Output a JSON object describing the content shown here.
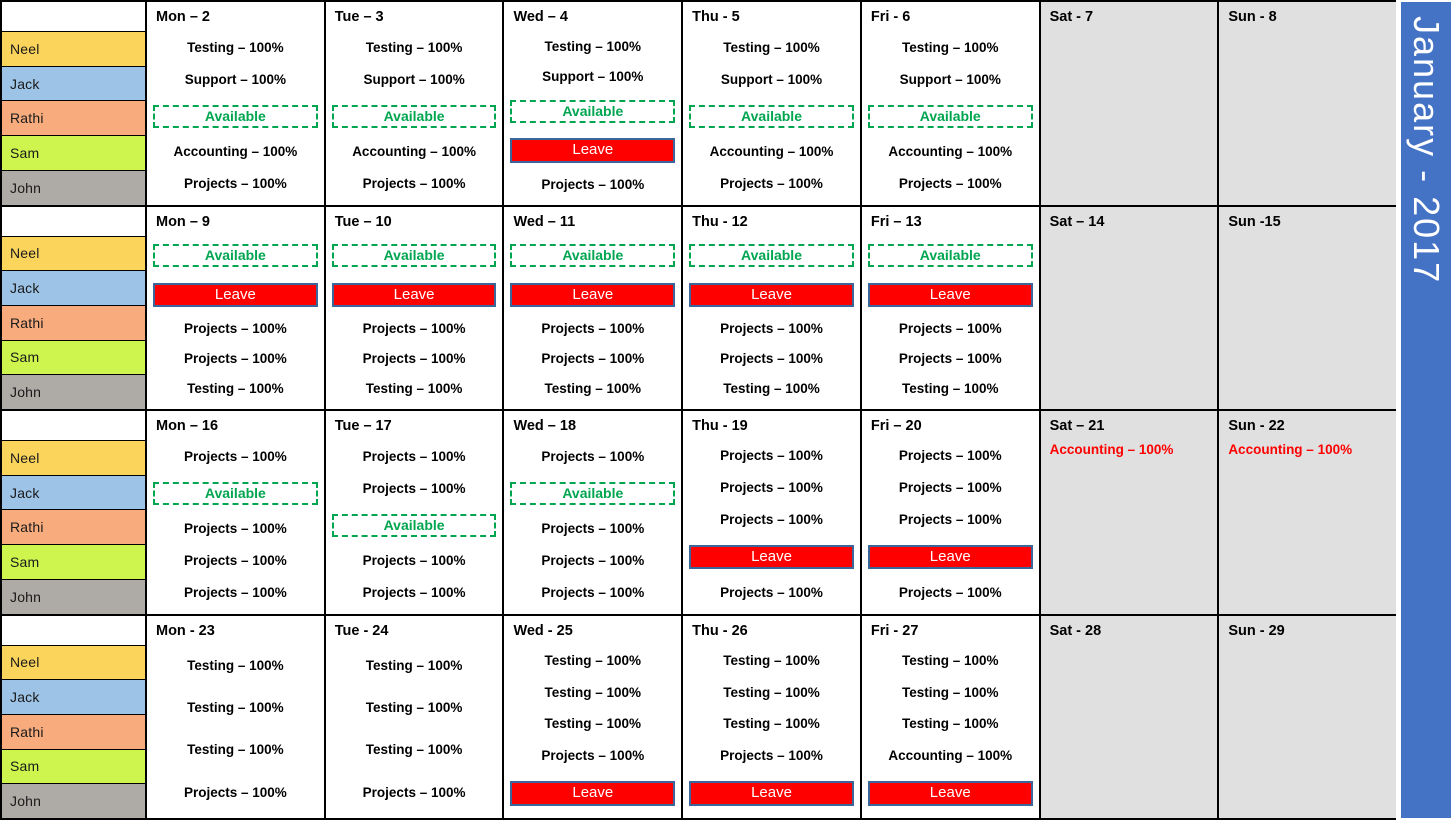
{
  "banner": {
    "month_label": "January - 2017",
    "color": "#4472C4"
  },
  "resources": [
    {
      "name": "Neel",
      "color": "#FBD45C"
    },
    {
      "name": "Jack",
      "color": "#9DC3E6"
    },
    {
      "name": "Rathi",
      "color": "#F8AC7D"
    },
    {
      "name": "Sam",
      "color": "#CDF54E"
    },
    {
      "name": "John",
      "color": "#AEAAA6"
    }
  ],
  "status_colors": {
    "available_text": "#00A550",
    "available_border": "#00A550",
    "leave_fill": "#FF0000",
    "leave_border": "#3B6699",
    "leave_text": "#FFFFFF",
    "weekend_entry_text": "#FF0000",
    "weekend_cell_fill": "#E0E0E0"
  },
  "weeks": [
    {
      "days": [
        {
          "header": "Mon – 2",
          "weekend": false,
          "entries": [
            {
              "text": "Testing – 100%",
              "type": "normal"
            },
            {
              "text": "Support – 100%",
              "type": "normal"
            },
            {
              "text": "Available",
              "type": "available"
            },
            {
              "text": "Accounting  – 100%",
              "type": "normal"
            },
            {
              "text": "Projects – 100%",
              "type": "normal"
            }
          ]
        },
        {
          "header": "Tue – 3",
          "weekend": false,
          "entries": [
            {
              "text": "Testing – 100%",
              "type": "normal"
            },
            {
              "text": "Support  – 100%",
              "type": "normal"
            },
            {
              "text": "Available",
              "type": "available"
            },
            {
              "text": "Accounting  – 100%",
              "type": "normal"
            },
            {
              "text": "Projects – 100%",
              "type": "normal"
            }
          ]
        },
        {
          "header": "Wed – 4",
          "weekend": false,
          "entries": [
            {
              "text": "Testing – 100%",
              "type": "normal"
            },
            {
              "text": "Support – 100%",
              "type": "normal"
            },
            {
              "text": "Available",
              "type": "available"
            },
            {
              "text": "Leave",
              "type": "leave"
            },
            {
              "text": "Projects – 100%",
              "type": "normal"
            }
          ]
        },
        {
          "header": "Thu - 5",
          "weekend": false,
          "entries": [
            {
              "text": "Testing – 100%",
              "type": "normal"
            },
            {
              "text": "Support – 100%",
              "type": "normal"
            },
            {
              "text": "Available",
              "type": "available"
            },
            {
              "text": "Accounting  – 100%",
              "type": "normal"
            },
            {
              "text": "Projects – 100%",
              "type": "normal"
            }
          ]
        },
        {
          "header": "Fri - 6",
          "weekend": false,
          "entries": [
            {
              "text": "Testing – 100%",
              "type": "normal"
            },
            {
              "text": "Support – 100%",
              "type": "normal"
            },
            {
              "text": "Available",
              "type": "available"
            },
            {
              "text": "Accounting  – 100%",
              "type": "normal"
            },
            {
              "text": "Projects – 100%",
              "type": "normal"
            }
          ]
        },
        {
          "header": "Sat - 7",
          "weekend": true,
          "entries": []
        },
        {
          "header": "Sun - 8",
          "weekend": true,
          "entries": []
        }
      ]
    },
    {
      "days": [
        {
          "header": "Mon – 9",
          "weekend": false,
          "entries": [
            {
              "text": "Available",
              "type": "available"
            },
            {
              "text": "Leave",
              "type": "leave"
            },
            {
              "text": "Projects – 100%",
              "type": "normal"
            },
            {
              "text": "Projects – 100%",
              "type": "normal"
            },
            {
              "text": "Testing – 100%",
              "type": "normal"
            }
          ]
        },
        {
          "header": "Tue – 10",
          "weekend": false,
          "entries": [
            {
              "text": "Available",
              "type": "available"
            },
            {
              "text": "Leave",
              "type": "leave"
            },
            {
              "text": "Projects – 100%",
              "type": "normal"
            },
            {
              "text": "Projects – 100%",
              "type": "normal"
            },
            {
              "text": "Testing – 100%",
              "type": "normal"
            }
          ]
        },
        {
          "header": "Wed – 11",
          "weekend": false,
          "entries": [
            {
              "text": "Available",
              "type": "available"
            },
            {
              "text": "Leave",
              "type": "leave"
            },
            {
              "text": "Projects – 100%",
              "type": "normal"
            },
            {
              "text": "Projects – 100%",
              "type": "normal"
            },
            {
              "text": "Testing – 100%",
              "type": "normal"
            }
          ]
        },
        {
          "header": "Thu - 12",
          "weekend": false,
          "entries": [
            {
              "text": "Available",
              "type": "available"
            },
            {
              "text": "Leave",
              "type": "leave"
            },
            {
              "text": "Projects – 100%",
              "type": "normal"
            },
            {
              "text": "Projects – 100%",
              "type": "normal"
            },
            {
              "text": "Testing – 100%",
              "type": "normal"
            }
          ]
        },
        {
          "header": "Fri – 13",
          "weekend": false,
          "entries": [
            {
              "text": "Available",
              "type": "available"
            },
            {
              "text": "Leave",
              "type": "leave"
            },
            {
              "text": "Projects – 100%",
              "type": "normal"
            },
            {
              "text": "Projects – 100%",
              "type": "normal"
            },
            {
              "text": "Testing – 100%",
              "type": "normal"
            }
          ]
        },
        {
          "header": "Sat – 14",
          "weekend": true,
          "entries": []
        },
        {
          "header": "Sun -15",
          "weekend": true,
          "entries": []
        }
      ]
    },
    {
      "days": [
        {
          "header": "Mon – 16",
          "weekend": false,
          "entries": [
            {
              "text": "Projects – 100%",
              "type": "normal"
            },
            {
              "text": "Available",
              "type": "available"
            },
            {
              "text": "Projects – 100%",
              "type": "normal"
            },
            {
              "text": "Projects – 100%",
              "type": "normal"
            },
            {
              "text": "Projects – 100%",
              "type": "normal"
            }
          ]
        },
        {
          "header": "Tue – 17",
          "weekend": false,
          "entries": [
            {
              "text": "Projects – 100%",
              "type": "normal"
            },
            {
              "text": "Projects – 100%",
              "type": "normal"
            },
            {
              "text": "Available",
              "type": "available"
            },
            {
              "text": "Projects – 100%",
              "type": "normal"
            },
            {
              "text": "Projects – 100%",
              "type": "normal"
            }
          ]
        },
        {
          "header": "Wed – 18",
          "weekend": false,
          "entries": [
            {
              "text": "Projects – 100%",
              "type": "normal"
            },
            {
              "text": "Available",
              "type": "available"
            },
            {
              "text": "Projects – 100%",
              "type": "normal"
            },
            {
              "text": "Projects – 100%",
              "type": "normal"
            },
            {
              "text": "Projects – 100%",
              "type": "normal"
            }
          ]
        },
        {
          "header": "Thu - 19",
          "weekend": false,
          "entries": [
            {
              "text": "Projects – 100%",
              "type": "normal"
            },
            {
              "text": "Projects – 100%",
              "type": "normal"
            },
            {
              "text": "Projects – 100%",
              "type": "normal"
            },
            {
              "text": "Leave",
              "type": "leave"
            },
            {
              "text": "Projects – 100%",
              "type": "normal"
            }
          ]
        },
        {
          "header": "Fri – 20",
          "weekend": false,
          "entries": [
            {
              "text": "Projects – 100%",
              "type": "normal"
            },
            {
              "text": "Projects – 100%",
              "type": "normal"
            },
            {
              "text": "Projects – 100%",
              "type": "normal"
            },
            {
              "text": "Leave",
              "type": "leave"
            },
            {
              "text": "Projects – 100%",
              "type": "normal"
            }
          ]
        },
        {
          "header": "Sat – 21",
          "weekend": true,
          "entries": [
            {
              "text": "Accounting  – 100%",
              "type": "weekend-entry"
            }
          ]
        },
        {
          "header": "Sun - 22",
          "weekend": true,
          "entries": [
            {
              "text": "Accounting  – 100%",
              "type": "weekend-entry"
            }
          ]
        }
      ]
    },
    {
      "days": [
        {
          "header": "Mon - 23",
          "weekend": false,
          "entries": [
            {
              "text": "Testing – 100%",
              "type": "normal"
            },
            {
              "text": "Testing – 100%",
              "type": "normal"
            },
            {
              "text": "Testing – 100%",
              "type": "normal"
            },
            {
              "text": "Projects – 100%",
              "type": "normal"
            }
          ]
        },
        {
          "header": "Tue - 24",
          "weekend": false,
          "entries": [
            {
              "text": "Testing – 100%",
              "type": "normal"
            },
            {
              "text": "Testing – 100%",
              "type": "normal"
            },
            {
              "text": "Testing – 100%",
              "type": "normal"
            },
            {
              "text": "Projects – 100%",
              "type": "normal"
            }
          ]
        },
        {
          "header": "Wed - 25",
          "weekend": false,
          "entries": [
            {
              "text": "Testing – 100%",
              "type": "normal"
            },
            {
              "text": "Testing – 100%",
              "type": "normal"
            },
            {
              "text": "Testing – 100%",
              "type": "normal"
            },
            {
              "text": "Projects – 100%",
              "type": "normal"
            },
            {
              "text": "Leave",
              "type": "leave"
            }
          ]
        },
        {
          "header": "Thu - 26",
          "weekend": false,
          "entries": [
            {
              "text": "Testing – 100%",
              "type": "normal"
            },
            {
              "text": "Testing – 100%",
              "type": "normal"
            },
            {
              "text": "Testing – 100%",
              "type": "normal"
            },
            {
              "text": "Projects – 100%",
              "type": "normal"
            },
            {
              "text": "Leave",
              "type": "leave"
            }
          ]
        },
        {
          "header": "Fri - 27",
          "weekend": false,
          "entries": [
            {
              "text": "Testing – 100%",
              "type": "normal"
            },
            {
              "text": "Testing – 100%",
              "type": "normal"
            },
            {
              "text": "Testing – 100%",
              "type": "normal"
            },
            {
              "text": "Accounting  – 100%",
              "type": "normal"
            },
            {
              "text": "Leave",
              "type": "leave"
            }
          ]
        },
        {
          "header": "Sat - 28",
          "weekend": true,
          "entries": []
        },
        {
          "header": "Sun - 29",
          "weekend": true,
          "entries": []
        }
      ]
    }
  ]
}
